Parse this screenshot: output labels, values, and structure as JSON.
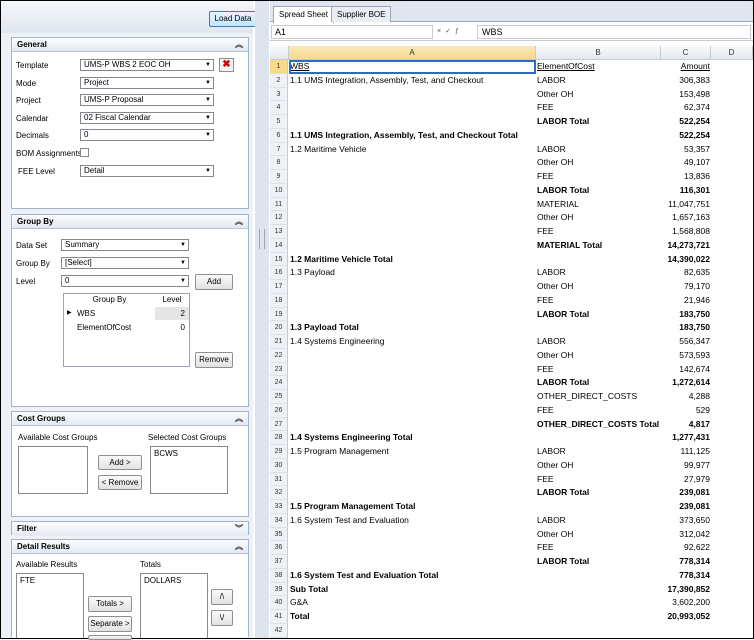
{
  "toolbar": {
    "load_data": "Load Data"
  },
  "general": {
    "title": "General",
    "template_label": "Template",
    "template_value": "UMS-P WBS 2 EOC OH",
    "mode_label": "Mode",
    "mode_value": "Project",
    "project_label": "Project",
    "project_value": "UMS-P Proposal",
    "calendar_label": "Calendar",
    "calendar_value": "02 Fiscal Calendar",
    "decimals_label": "Decimals",
    "decimals_value": "0",
    "bom_label": "BOM Assignments",
    "fee_label": "FEE Level",
    "fee_value": "Detail"
  },
  "groupby": {
    "title": "Group By",
    "dataset_label": "Data Set",
    "dataset_value": "Summary",
    "groupby_label": "Group By",
    "groupby_value": "[Select]",
    "level_label": "Level",
    "level_value": "0",
    "add": "Add",
    "remove": "Remove",
    "col_groupby": "Group By",
    "col_level": "Level",
    "rows": [
      {
        "name": "WBS",
        "level": "2"
      },
      {
        "name": "ElementOfCost",
        "level": "0"
      }
    ]
  },
  "costgroups": {
    "title": "Cost Groups",
    "available_label": "Available Cost Groups",
    "selected_label": "Selected Cost Groups",
    "selected_items": [
      "BCWS"
    ],
    "add": "Add >",
    "remove": "< Remove"
  },
  "filter": {
    "title": "Filter"
  },
  "detail": {
    "title": "Detail Results",
    "available_label": "Available Results",
    "totals_label": "Totals",
    "available_items": [
      "FTE"
    ],
    "totals_items": [
      "DOLLARS"
    ],
    "totals_btn": "Totals >",
    "separate_btn": "Separate >",
    "up_btn": "/\\",
    "down_btn": "\\/"
  },
  "tabs": [
    "Spread Sheet",
    "Supplier BOE"
  ],
  "formula": {
    "cell": "A1",
    "value": "WBS"
  },
  "columns": [
    "A",
    "B",
    "C",
    "D"
  ],
  "sheet": [
    {
      "a": "WBS",
      "b": "ElementOfCost",
      "c": "Amount",
      "style": "header"
    },
    {
      "a": "1.1 UMS Integration, Assembly, Test, and Checkout",
      "b": "LABOR",
      "c": "306,383"
    },
    {
      "a": "",
      "b": "Other OH",
      "c": "153,498"
    },
    {
      "a": "",
      "b": "FEE",
      "c": "62,374"
    },
    {
      "a": "",
      "b": "LABOR Total",
      "c": "522,254",
      "style": "btotal"
    },
    {
      "a": "1.1 UMS Integration, Assembly, Test, and Checkout Total",
      "b": "",
      "c": "522,254",
      "style": "total"
    },
    {
      "a": "1.2 Maritime Vehicle",
      "b": "LABOR",
      "c": "53,357"
    },
    {
      "a": "",
      "b": "Other OH",
      "c": "49,107"
    },
    {
      "a": "",
      "b": "FEE",
      "c": "13,836"
    },
    {
      "a": "",
      "b": "LABOR Total",
      "c": "116,301",
      "style": "btotal"
    },
    {
      "a": "",
      "b": "MATERIAL",
      "c": "11,047,751"
    },
    {
      "a": "",
      "b": "Other OH",
      "c": "1,657,163"
    },
    {
      "a": "",
      "b": "FEE",
      "c": "1,568,808"
    },
    {
      "a": "",
      "b": "MATERIAL Total",
      "c": "14,273,721",
      "style": "btotal"
    },
    {
      "a": "1.2 Maritime Vehicle Total",
      "b": "",
      "c": "14,390,022",
      "style": "total"
    },
    {
      "a": "1.3 Payload",
      "b": "LABOR",
      "c": "82,635"
    },
    {
      "a": "",
      "b": "Other OH",
      "c": "79,170"
    },
    {
      "a": "",
      "b": "FEE",
      "c": "21,946"
    },
    {
      "a": "",
      "b": "LABOR Total",
      "c": "183,750",
      "style": "btotal"
    },
    {
      "a": "1.3 Payload Total",
      "b": "",
      "c": "183,750",
      "style": "total"
    },
    {
      "a": "1.4 Systems Engineering",
      "b": "LABOR",
      "c": "556,347"
    },
    {
      "a": "",
      "b": "Other OH",
      "c": "573,593"
    },
    {
      "a": "",
      "b": "FEE",
      "c": "142,674"
    },
    {
      "a": "",
      "b": "LABOR Total",
      "c": "1,272,614",
      "style": "btotal"
    },
    {
      "a": "",
      "b": "OTHER_DIRECT_COSTS",
      "c": "4,288"
    },
    {
      "a": "",
      "b": "FEE",
      "c": "529"
    },
    {
      "a": "",
      "b": "OTHER_DIRECT_COSTS Total",
      "c": "4,817",
      "style": "btotal"
    },
    {
      "a": "1.4 Systems Engineering Total",
      "b": "",
      "c": "1,277,431",
      "style": "total"
    },
    {
      "a": "1.5 Program Management",
      "b": "LABOR",
      "c": "111,125"
    },
    {
      "a": "",
      "b": "Other OH",
      "c": "99,977"
    },
    {
      "a": "",
      "b": "FEE",
      "c": "27,979"
    },
    {
      "a": "",
      "b": "LABOR Total",
      "c": "239,081",
      "style": "btotal"
    },
    {
      "a": "1.5 Program Management Total",
      "b": "",
      "c": "239,081",
      "style": "total"
    },
    {
      "a": "1.6 System Test and Evaluation",
      "b": "LABOR",
      "c": "373,650"
    },
    {
      "a": "",
      "b": "Other OH",
      "c": "312,042"
    },
    {
      "a": "",
      "b": "FEE",
      "c": "92,622"
    },
    {
      "a": "",
      "b": "LABOR Total",
      "c": "778,314",
      "style": "btotal"
    },
    {
      "a": "1.6 System Test and Evaluation Total",
      "b": "",
      "c": "778,314",
      "style": "total"
    },
    {
      "a": "Sub Total",
      "b": "",
      "c": "17,390,852",
      "style": "total"
    },
    {
      "a": "G&A",
      "b": "",
      "c": "3,602,200"
    },
    {
      "a": "Total",
      "b": "",
      "c": "20,993,052",
      "style": "total"
    },
    {
      "a": "",
      "b": "",
      "c": ""
    }
  ]
}
